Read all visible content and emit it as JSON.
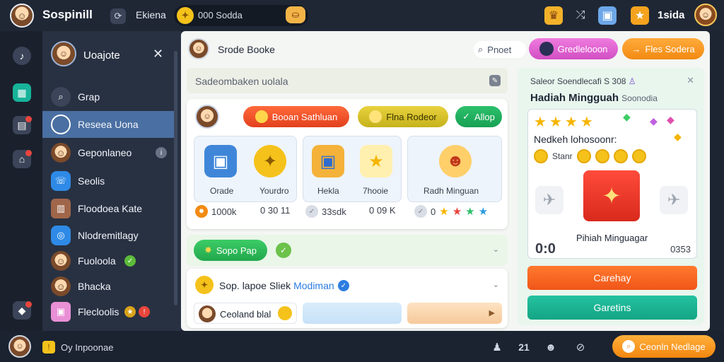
{
  "topbar": {
    "brand": "Sospinill",
    "tab": "Ekiena",
    "coin_text": "000 Sodda",
    "right_text": "1sida"
  },
  "sidebar": {
    "title": "Uoajote",
    "items": [
      {
        "label": "Grap"
      },
      {
        "label": "Reseea Uona"
      },
      {
        "label": "Geponlaneo"
      },
      {
        "label": "Seolis"
      },
      {
        "label": "Floodoea Kate"
      },
      {
        "label": "Nlodremitlagy"
      },
      {
        "label": "Fuoloola"
      },
      {
        "label": "Bhacka"
      },
      {
        "label": "Flecloolis"
      }
    ]
  },
  "main": {
    "title": "Srode Booke",
    "search_label": "Pnoet",
    "btn_purple": "Gredlelooon",
    "btn_orange": "Fles Sodera",
    "search_box": "Sadeombaken uolala",
    "card_a": {
      "btn_red": "Booan Sathluan",
      "btn_yellow": "Flna Rodeor",
      "btn_green": "Allop",
      "tiles": [
        {
          "caps": [
            "Orade",
            "Yourdro"
          ]
        },
        {
          "caps": [
            "Hekla",
            "7hooie"
          ]
        },
        {
          "caps": [
            "Radh Minguan"
          ]
        }
      ],
      "stats": [
        "1000k",
        "0 30 11",
        "33sdk",
        "0 09 K",
        "0"
      ]
    },
    "bar_b": {
      "btn": "Sopo Pap"
    },
    "card_c": {
      "title_a": "Sop. lapoe Sliek ",
      "title_b": "Modiman",
      "mini1": "Ceoland blal"
    }
  },
  "reward": {
    "subtitle": "Saleor Soendlecafi S 308",
    "title": "Hadiah Mingguah",
    "title_muted": "Soonodia",
    "heading": "Nedkeh lohosoonr:",
    "coins_label": "Stanr",
    "caption": "Pihiah Minguagar",
    "big": "0:0",
    "right": "0353",
    "btn1": "Carehay",
    "btn2": "Garetins"
  },
  "bottombar": {
    "text": "Oy Inpoonae",
    "right_num": "21",
    "pill": "Ceonln Nedlage"
  }
}
